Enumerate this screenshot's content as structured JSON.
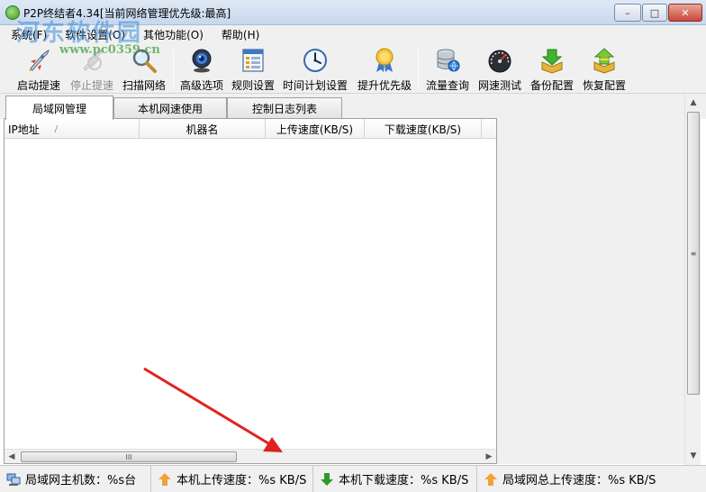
{
  "window": {
    "title": "P2P终结者4.34[当前网络管理优先级:最高]",
    "minimize_glyph": "–",
    "maximize_glyph": "□",
    "close_glyph": "✕"
  },
  "watermark": {
    "text": "河东软件园",
    "url": "www.pc0359.cn"
  },
  "menu": [
    {
      "label": "系统(F)"
    },
    {
      "label": "软件设置(O)"
    },
    {
      "label": "其他功能(O)"
    },
    {
      "label": "帮助(H)"
    }
  ],
  "toolbar": [
    {
      "label": "启动提速",
      "icon": "rocket-icon",
      "enabled": true
    },
    {
      "label": "停止提速",
      "icon": "stop-rocket-icon",
      "enabled": false
    },
    {
      "label": "扫描网络",
      "icon": "magnifier-icon",
      "enabled": true
    },
    {
      "label": "高级选项",
      "icon": "webcam-icon",
      "enabled": true
    },
    {
      "label": "规则设置",
      "icon": "rules-icon",
      "enabled": true
    },
    {
      "label": "时间计划设置",
      "icon": "clock-icon",
      "enabled": true
    },
    {
      "label": "提升优先级",
      "icon": "medal-icon",
      "enabled": true
    },
    {
      "label": "流量查询",
      "icon": "database-icon",
      "enabled": true
    },
    {
      "label": "网速测试",
      "icon": "speedometer-icon",
      "enabled": true
    },
    {
      "label": "备份配置",
      "icon": "backup-icon",
      "enabled": true
    },
    {
      "label": "恢复配置",
      "icon": "restore-icon",
      "enabled": true
    }
  ],
  "tabs": [
    {
      "label": "局域网管理",
      "active": true
    },
    {
      "label": "本机网速使用",
      "active": false
    },
    {
      "label": "控制日志列表",
      "active": false
    }
  ],
  "table": {
    "columns": [
      "IP地址",
      "机器名",
      "上传速度(KB/S)",
      "下载速度(KB/S)"
    ],
    "sort_indicator": "/",
    "rows": []
  },
  "scrollbar": {
    "grip": "III"
  },
  "status": [
    {
      "text": "局域网主机数：%s台",
      "icon": "network-icon"
    },
    {
      "text": "本机上传速度：%s KB/S",
      "icon": "upload-arrow-icon"
    },
    {
      "text": "本机下载速度：%s KB/S",
      "icon": "download-arrow-icon"
    },
    {
      "text": "局域网总上传速度：%s KB/S",
      "icon": "upload-arrow-icon"
    }
  ],
  "colors": {
    "upload_arrow": "#f2a23a",
    "download_arrow": "#2f9a2a",
    "annotation_arrow": "#e0221e"
  }
}
